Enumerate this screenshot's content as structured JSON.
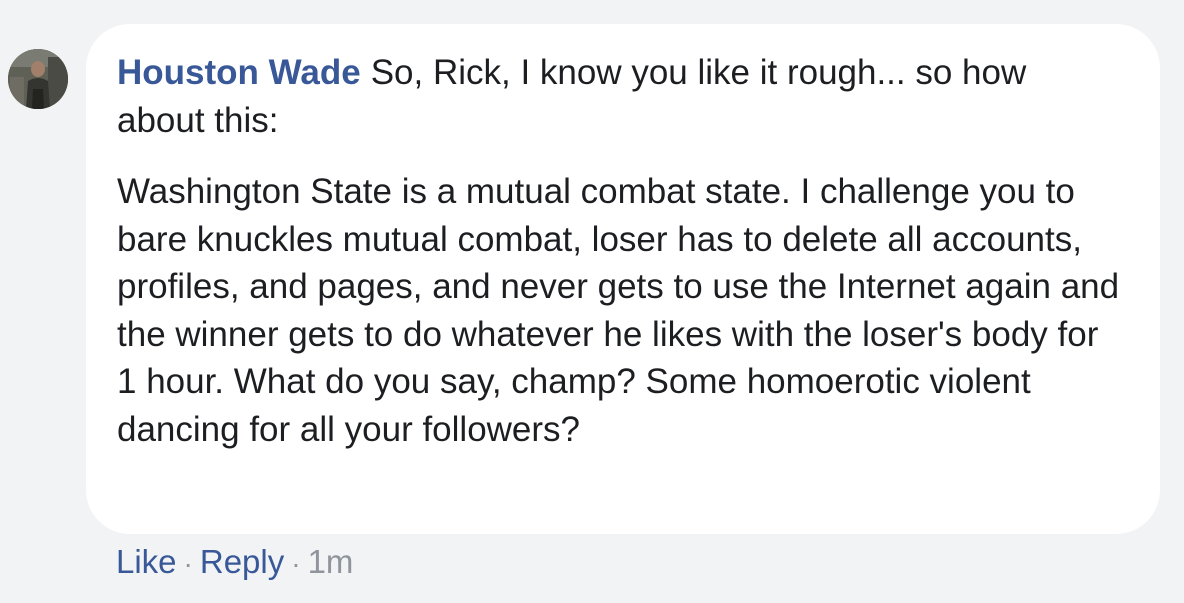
{
  "comment": {
    "author": "Houston Wade",
    "intro": "So, Rick, I know you like it rough... so how about this:",
    "body": "Washington State is a mutual combat state. I challenge you to bare knuckles mutual combat, loser has to delete all accounts, profiles, and pages, and never gets to use the Internet again and the winner gets to do whatever he likes with the loser's body for 1 hour. What do you say, champ? Some homoerotic violent dancing for all your followers?",
    "avatar_icon": "profile-photo"
  },
  "actions": {
    "like_label": "Like",
    "separator": "·",
    "reply_label": "Reply",
    "timestamp": "1m"
  },
  "colors": {
    "page_background": "#f2f3f5",
    "bubble_background": "#ffffff",
    "author_link": "#385898",
    "text": "#1c1e21",
    "meta": "#90949c"
  }
}
